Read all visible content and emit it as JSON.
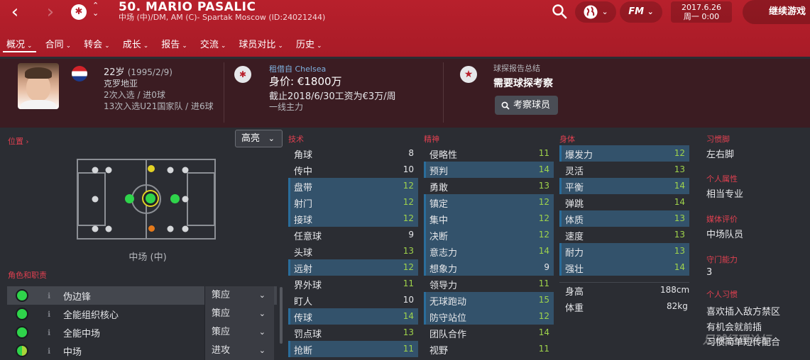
{
  "header": {
    "player_title": "50. MARIO PASALIC",
    "player_subtitle": "中场 (中)/DM, AM (C)- Spartak Moscow (ID:24021244)",
    "date_line1": "2017.6.26",
    "date_line2": "周一 0:00",
    "continue_label": "继续游戏",
    "fm_label": "FM"
  },
  "tabs": [
    {
      "label": "概况"
    },
    {
      "label": "合同"
    },
    {
      "label": "转会"
    },
    {
      "label": "成长"
    },
    {
      "label": "报告"
    },
    {
      "label": "交流"
    },
    {
      "label": "球员对比"
    },
    {
      "label": "历史"
    }
  ],
  "info": {
    "age": "22岁",
    "dob": "(1995/2/9)",
    "nationality": "克罗地亚",
    "caps": "2次入选 / 进0球",
    "u21_caps": "13次入选U21国家队 / 进6球",
    "loan_from_label": "租借自",
    "loan_from_club": "Chelsea",
    "value": "身价: €1800万",
    "contract": "截止2018/6/30工资为€3万/周",
    "squad_status": "一线主力",
    "scout_summary_label": "球探报告总结",
    "scout_summary": "需要球探考察",
    "scout_button": "考察球员"
  },
  "position": {
    "section_title": "位置",
    "highlight_select": "高亮",
    "position_label": "中场 (中)"
  },
  "roles": {
    "section_title": "角色和职责",
    "items": [
      {
        "name": "伪边锋",
        "duty": "策应"
      },
      {
        "name": "全能组织核心",
        "duty": "策应"
      },
      {
        "name": "全能中场",
        "duty": "策应"
      },
      {
        "name": "中场",
        "duty": "进攻"
      }
    ]
  },
  "technical": {
    "title": "技术",
    "items": [
      {
        "name": "角球",
        "value": "8"
      },
      {
        "name": "传中",
        "value": "10"
      },
      {
        "name": "盘带",
        "value": "12"
      },
      {
        "name": "射门",
        "value": "12"
      },
      {
        "name": "接球",
        "value": "12"
      },
      {
        "name": "任意球",
        "value": "9"
      },
      {
        "name": "头球",
        "value": "13"
      },
      {
        "name": "远射",
        "value": "12"
      },
      {
        "name": "界外球",
        "value": "11"
      },
      {
        "name": "盯人",
        "value": "10"
      },
      {
        "name": "传球",
        "value": "14"
      },
      {
        "name": "罚点球",
        "value": "13"
      },
      {
        "name": "抢断",
        "value": "11"
      }
    ]
  },
  "mental": {
    "title": "精神",
    "items": [
      {
        "name": "侵略性",
        "value": "11"
      },
      {
        "name": "预判",
        "value": "14"
      },
      {
        "name": "勇敢",
        "value": "13"
      },
      {
        "name": "镇定",
        "value": "12"
      },
      {
        "name": "集中",
        "value": "12"
      },
      {
        "name": "决断",
        "value": "12"
      },
      {
        "name": "意志力",
        "value": "14"
      },
      {
        "name": "想象力",
        "value": "9"
      },
      {
        "name": "领导力",
        "value": "11"
      },
      {
        "name": "无球跑动",
        "value": "15"
      },
      {
        "name": "防守站位",
        "value": "12"
      },
      {
        "name": "团队合作",
        "value": "14"
      },
      {
        "name": "视野",
        "value": "11"
      }
    ]
  },
  "physical": {
    "title": "身体",
    "items": [
      {
        "name": "爆发力",
        "value": "12"
      },
      {
        "name": "灵活",
        "value": "13"
      },
      {
        "name": "平衡",
        "value": "14"
      },
      {
        "name": "弹跳",
        "value": "14"
      },
      {
        "name": "体质",
        "value": "13"
      },
      {
        "name": "速度",
        "value": "13"
      },
      {
        "name": "耐力",
        "value": "13"
      },
      {
        "name": "强壮",
        "value": "14"
      }
    ],
    "height_label": "身高",
    "height_value": "188cm",
    "weight_label": "体重",
    "weight_value": "82kg"
  },
  "side": {
    "foot_label": "习惯脚",
    "foot_value": "左右脚",
    "personality_label": "个人属性",
    "personality_value": "相当专业",
    "media_label": "媒体评价",
    "media_value": "中场队员",
    "gk_label": "守门能力",
    "gk_value": "3",
    "habits_label": "个人习惯",
    "habits": [
      "喜欢插入敌方禁区",
      "有机会就前插",
      "习惯简单短传配合"
    ]
  },
  "watermark": "足球经理论坛"
}
